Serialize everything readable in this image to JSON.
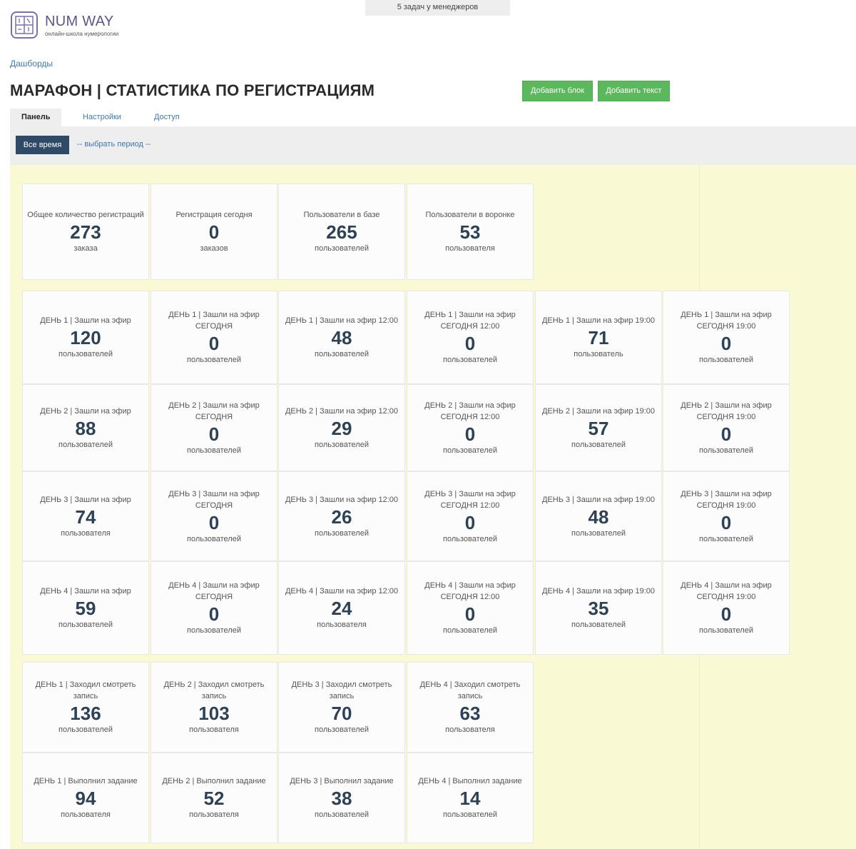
{
  "top_banner": "5 задач у менеджеров",
  "logo": {
    "name": "NUM WAY",
    "subtitle": "онлайн-школа нумерологии"
  },
  "breadcrumb": "Дашборды",
  "title": "МАРАФОН | СТАТИСТИКА ПО РЕГИСТРАЦИЯМ",
  "buttons": {
    "add_block": "Добавить блок",
    "add_text": "Добавить текст"
  },
  "tabs": [
    "Панель",
    "Настройки",
    "Доступ"
  ],
  "period": {
    "all_time": "Все время",
    "choose": "-- выбрать период --"
  },
  "rows": [
    [
      {
        "title": "Общее количество регистраций",
        "value": "273",
        "unit": "заказа"
      },
      {
        "title": "Регистрация сегодня",
        "value": "0",
        "unit": "заказов"
      },
      {
        "title": "Пользователи в базе",
        "value": "265",
        "unit": "пользователей"
      },
      {
        "title": "Пользователи в воронке",
        "value": "53",
        "unit": "пользователя"
      }
    ],
    [
      {
        "title": "ДЕНЬ 1 | Зашли на эфир",
        "value": "120",
        "unit": "пользователей"
      },
      {
        "title": "ДЕНЬ 1 | Зашли на эфир СЕГОДНЯ",
        "value": "0",
        "unit": "пользователей"
      },
      {
        "title": "ДЕНЬ 1 | Зашли на эфир 12:00",
        "value": "48",
        "unit": "пользователей"
      },
      {
        "title": "ДЕНЬ 1 | Зашли на эфир СЕГОДНЯ 12:00",
        "value": "0",
        "unit": "пользователей"
      },
      {
        "title": "ДЕНЬ 1 | Зашли на эфир 19:00",
        "value": "71",
        "unit": "пользователь"
      },
      {
        "title": "ДЕНЬ 1 | Зашли на эфир СЕГОДНЯ 19:00",
        "value": "0",
        "unit": "пользователей"
      }
    ],
    [
      {
        "title": "ДЕНЬ 2 | Зашли на эфир",
        "value": "88",
        "unit": "пользователей"
      },
      {
        "title": "ДЕНЬ 2 | Зашли на эфир СЕГОДНЯ",
        "value": "0",
        "unit": "пользователей"
      },
      {
        "title": "ДЕНЬ 2 | Зашли на эфир 12:00",
        "value": "29",
        "unit": "пользователей"
      },
      {
        "title": "ДЕНЬ 2 | Зашли на эфир СЕГОДНЯ 12:00",
        "value": "0",
        "unit": "пользователей"
      },
      {
        "title": "ДЕНЬ 2 | Зашли на эфир 19:00",
        "value": "57",
        "unit": "пользователей"
      },
      {
        "title": "ДЕНЬ 2 | Зашли на эфир СЕГОДНЯ 19:00",
        "value": "0",
        "unit": "пользователей"
      }
    ],
    [
      {
        "title": "ДЕНЬ 3 | Зашли на эфир",
        "value": "74",
        "unit": "пользователя"
      },
      {
        "title": "ДЕНЬ 3 | Зашли на эфир СЕГОДНЯ",
        "value": "0",
        "unit": "пользователей"
      },
      {
        "title": "ДЕНЬ 3 | Зашли на эфир 12:00",
        "value": "26",
        "unit": "пользователей"
      },
      {
        "title": "ДЕНЬ 3 | Зашли на эфир СЕГОДНЯ 12:00",
        "value": "0",
        "unit": "пользователей"
      },
      {
        "title": "ДЕНЬ 3 | Зашли на эфир 19:00",
        "value": "48",
        "unit": "пользователей"
      },
      {
        "title": "ДЕНЬ 3 | Зашли на эфир СЕГОДНЯ 19:00",
        "value": "0",
        "unit": "пользователей"
      }
    ],
    [
      {
        "title": "ДЕНЬ 4 | Зашли на эфир",
        "value": "59",
        "unit": "пользователей"
      },
      {
        "title": "ДЕНЬ 4 | Зашли на эфир СЕГОДНЯ",
        "value": "0",
        "unit": "пользователей"
      },
      {
        "title": "ДЕНЬ 4 | Зашли на эфир 12:00",
        "value": "24",
        "unit": "пользователя"
      },
      {
        "title": "ДЕНЬ 4 | Зашли на эфир СЕГОДНЯ 12:00",
        "value": "0",
        "unit": "пользователей"
      },
      {
        "title": "ДЕНЬ 4 | Зашли на эфир 19:00",
        "value": "35",
        "unit": "пользователей"
      },
      {
        "title": "ДЕНЬ 4 | Зашли на эфир СЕГОДНЯ 19:00",
        "value": "0",
        "unit": "пользователей"
      }
    ],
    [
      {
        "title": "ДЕНЬ 1 | Заходил смотреть запись",
        "value": "136",
        "unit": "пользователей"
      },
      {
        "title": "ДЕНЬ 2 | Заходил смотреть запись",
        "value": "103",
        "unit": "пользователя"
      },
      {
        "title": "ДЕНЬ 3 | Заходил смотреть запись",
        "value": "70",
        "unit": "пользователей"
      },
      {
        "title": "ДЕНЬ 4 | Заходил смотреть запись",
        "value": "63",
        "unit": "пользователя"
      }
    ],
    [
      {
        "title": "ДЕНЬ 1 | Выполнил задание",
        "value": "94",
        "unit": "пользователя"
      },
      {
        "title": "ДЕНЬ 2 | Выполнил задание",
        "value": "52",
        "unit": "пользователя"
      },
      {
        "title": "ДЕНЬ 3 | Выполнил задание",
        "value": "38",
        "unit": "пользователей"
      },
      {
        "title": "ДЕНЬ 4 | Выполнил задание",
        "value": "14",
        "unit": "пользователей"
      }
    ]
  ]
}
